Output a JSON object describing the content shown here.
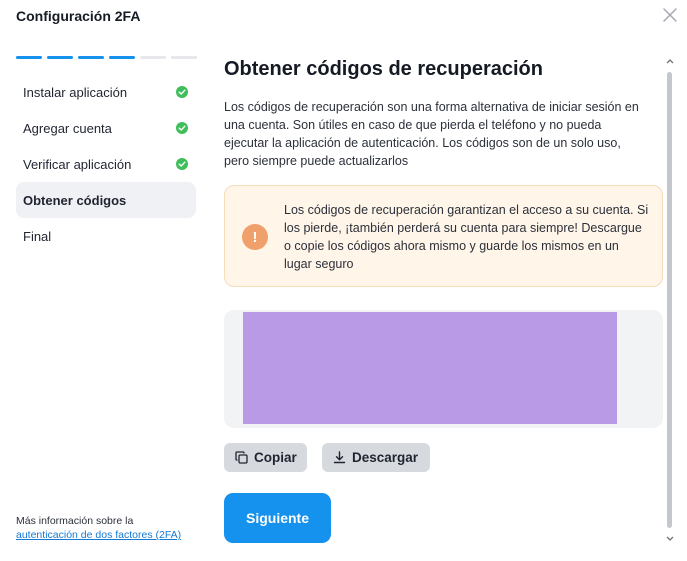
{
  "dialog": {
    "title": "Configuración 2FA",
    "close_icon": "close-icon"
  },
  "progress": {
    "total_steps": 6,
    "completed_steps": 4
  },
  "steps": [
    {
      "label": "Instalar aplicación",
      "done": true
    },
    {
      "label": "Agregar cuenta",
      "done": true
    },
    {
      "label": "Verificar aplicación",
      "done": true
    },
    {
      "label": "Obtener códigos",
      "done": false,
      "active": true
    },
    {
      "label": "Final",
      "done": false
    }
  ],
  "footer": {
    "more_info_text": "Más información sobre la",
    "more_info_link": "autenticación de dos factores (2FA)"
  },
  "main": {
    "title": "Obtener códigos de recuperación",
    "description": "Los códigos de recuperación son una forma alternativa de iniciar sesión en una cuenta. Son útiles en caso de que pierda el teléfono y no pueda ejecutar la aplicación de autenticación. Los códigos son de un solo uso, pero siempre puede actualizarlos",
    "warning": {
      "icon": "exclamation-icon",
      "text": "Los códigos de recuperación garantizan el acceso a su cuenta. Si los pierde, ¡también perderá su cuenta para siempre! Descargue o copie los códigos ahora mismo y guarde los mismos en un lugar seguro"
    },
    "codes_redacted": true,
    "buttons": {
      "copy": "Copiar",
      "download": "Descargar",
      "next": "Siguiente"
    }
  },
  "colors": {
    "accent": "#1591ee",
    "success": "#3fbf5b",
    "warning_bg": "#fff5e8",
    "warning_icon": "#f0a06a",
    "redaction": "#b99ae6"
  }
}
